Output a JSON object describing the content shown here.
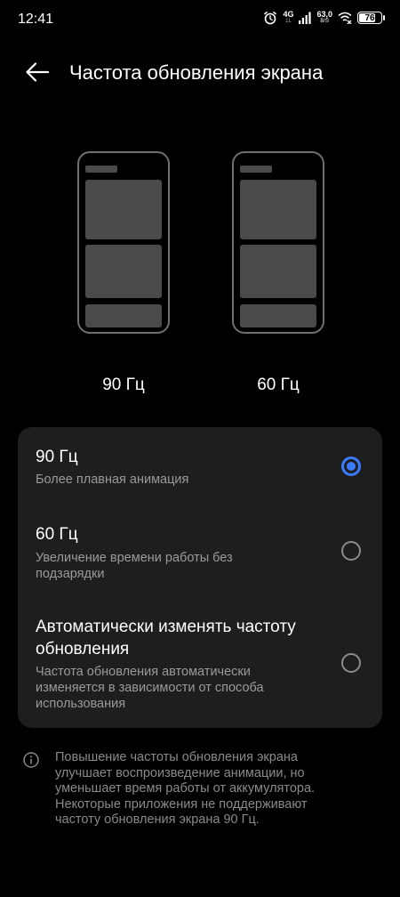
{
  "status_bar": {
    "time": "12:41",
    "network": "4G",
    "network_sub": "1L",
    "speed_value": "63,0",
    "speed_unit": "B/S",
    "battery": "76",
    "battery_level_percent": 76,
    "icons": [
      "alarm-icon",
      "signal-icon",
      "wifi-x-icon",
      "battery-icon"
    ]
  },
  "header": {
    "back_icon": "arrow-left-icon",
    "title": "Частота обновления экрана"
  },
  "previews": [
    {
      "label": "90 Гц"
    },
    {
      "label": "60 Гц"
    }
  ],
  "options": [
    {
      "title": "90 Гц",
      "description": "Более плавная анимация",
      "selected": true
    },
    {
      "title": "60 Гц",
      "description": "Увеличение времени работы без подзарядки",
      "selected": false
    },
    {
      "title": "Автоматически изменять частоту обновления",
      "description": "Частота обновления автоматически изменяется в зависимости от способа использования",
      "selected": false
    }
  ],
  "footnote": {
    "icon": "info-icon",
    "text": "Повышение частоты обновления экрана улучшает воспроизведение анимации, но уменьшает время работы от аккумулятора. Некоторые приложения не поддерживают частоту обновления экрана 90 Гц."
  },
  "colors": {
    "background": "#000000",
    "card": "#1e1e1f",
    "accent": "#3a7bff",
    "secondary_text": "#9a9a9a"
  }
}
